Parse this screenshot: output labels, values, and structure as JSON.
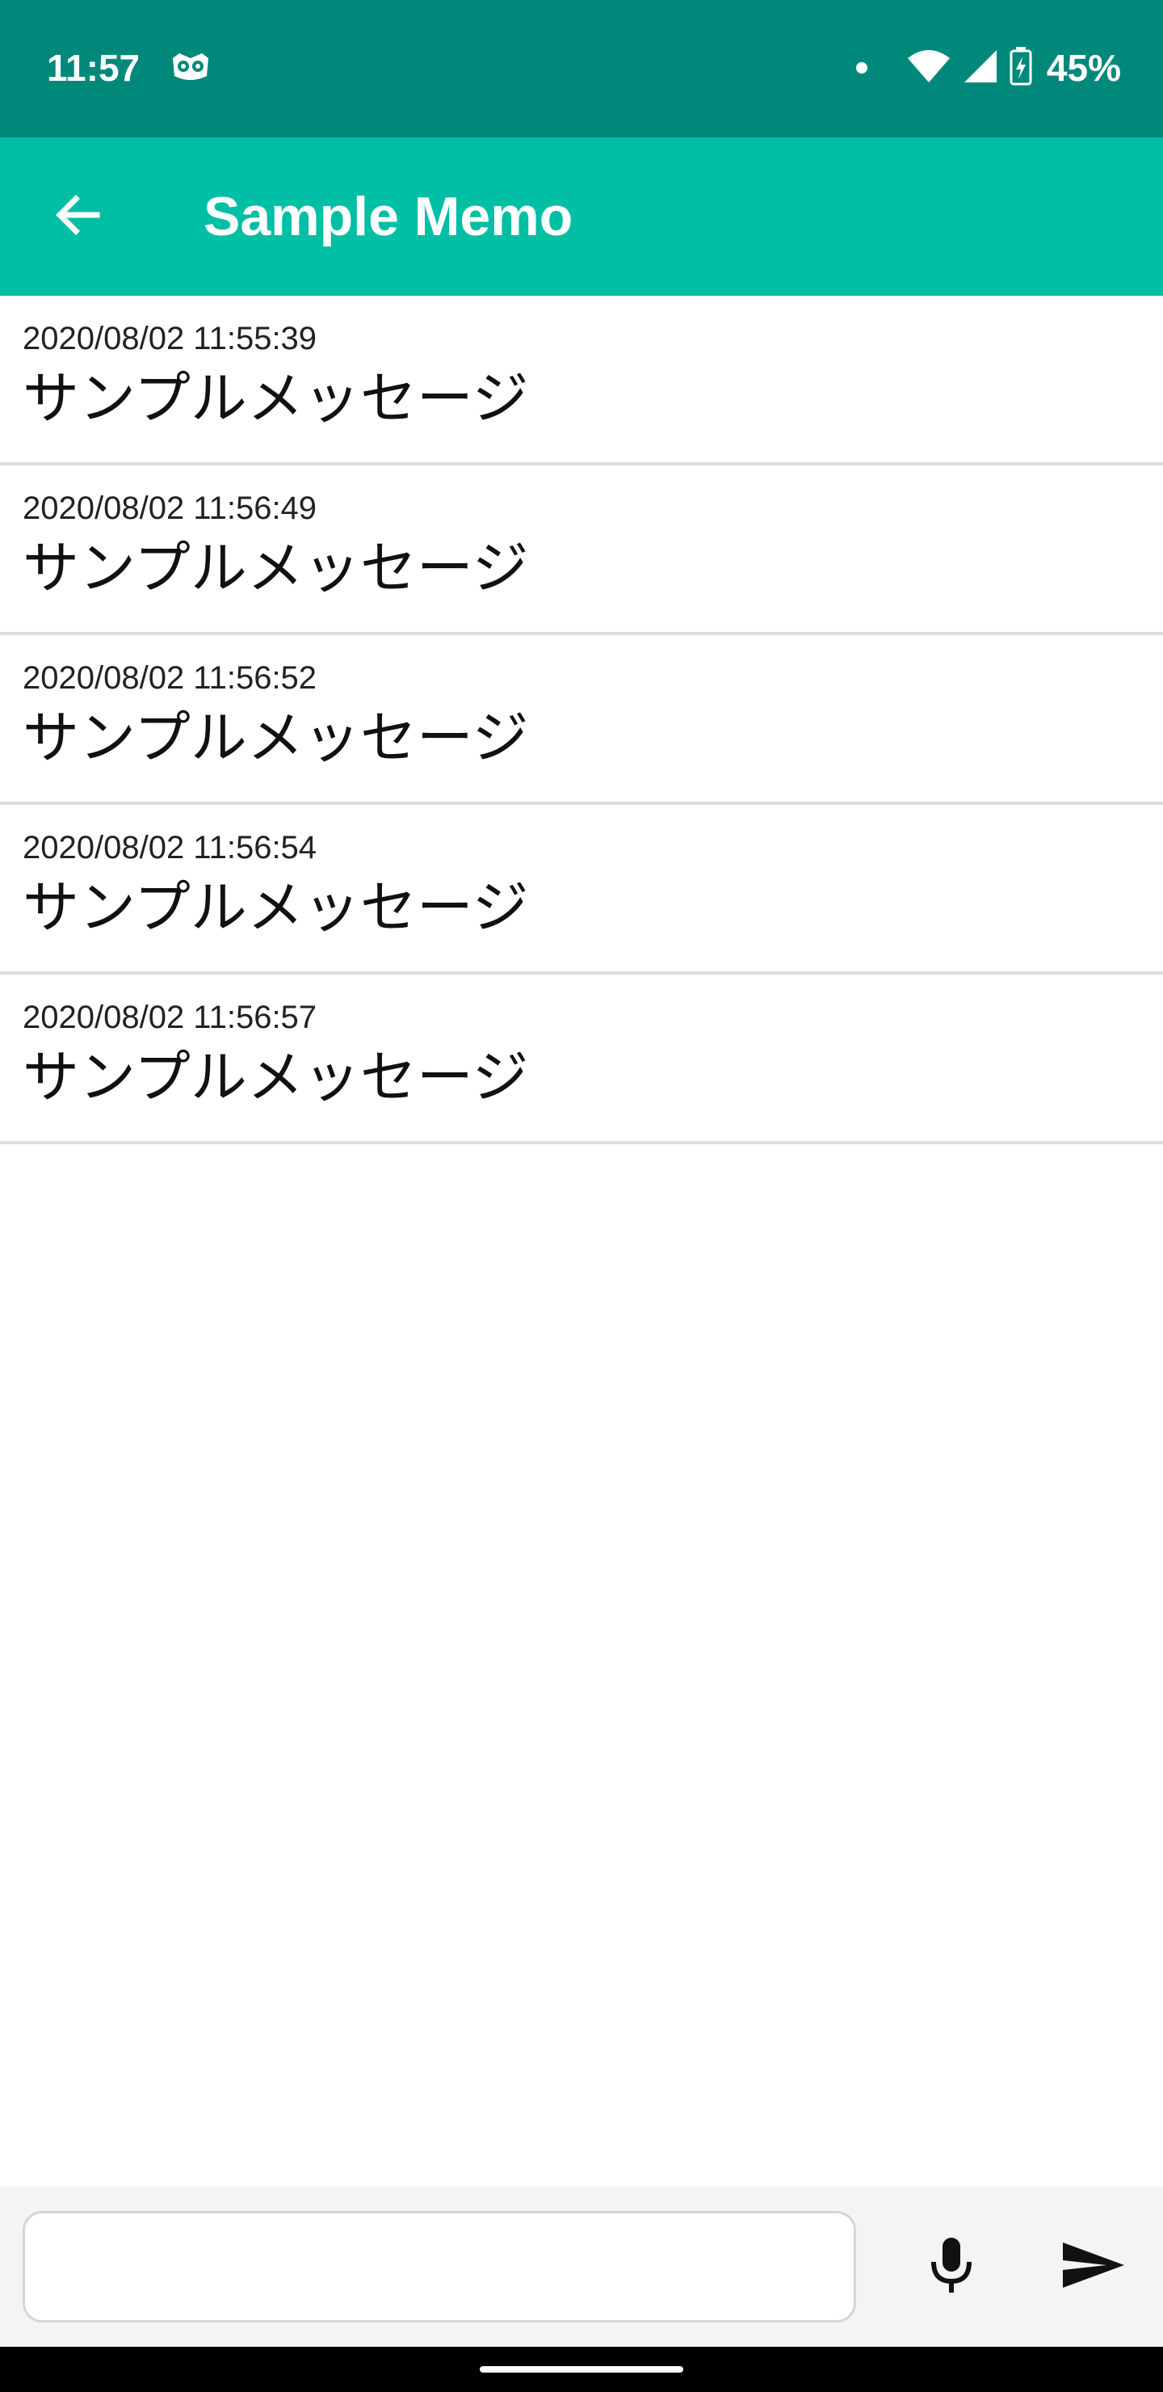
{
  "status_bar": {
    "time": "11:57",
    "battery": "45%",
    "icons": [
      "owl-icon",
      "notification-dot-icon",
      "wifi-icon",
      "cell-signal-icon",
      "battery-charging-icon"
    ]
  },
  "app_bar": {
    "title": "Sample Memo",
    "back_icon": "arrow-back-icon"
  },
  "memos": [
    {
      "time": "2020/08/02 11:55:39",
      "text": "サンプルメッセージ"
    },
    {
      "time": "2020/08/02 11:56:49",
      "text": "サンプルメッセージ"
    },
    {
      "time": "2020/08/02 11:56:52",
      "text": "サンプルメッセージ"
    },
    {
      "time": "2020/08/02 11:56:54",
      "text": "サンプルメッセージ"
    },
    {
      "time": "2020/08/02 11:56:57",
      "text": "サンプルメッセージ"
    }
  ],
  "composer": {
    "value": "",
    "placeholder": "",
    "mic_icon": "mic-icon",
    "send_icon": "send-icon"
  },
  "colors": {
    "status_bar": "#00897b",
    "app_bar": "#00bfa5",
    "divider": "#dddddd",
    "composer_background": "#f4f4f4"
  }
}
